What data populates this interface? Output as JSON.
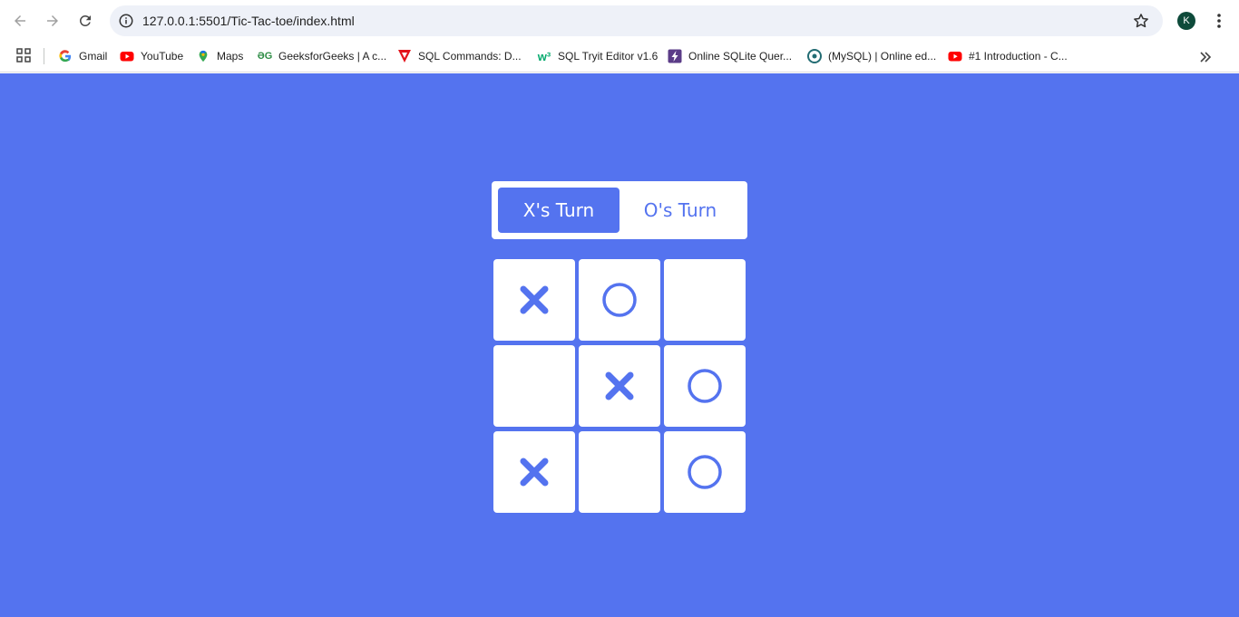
{
  "browser": {
    "url": "127.0.0.1:5501/Tic-Tac-toe/index.html",
    "profile_initial": "K",
    "bookmarks": [
      {
        "label": "Gmail",
        "icon": "google-icon"
      },
      {
        "label": "YouTube",
        "icon": "youtube-icon"
      },
      {
        "label": "Maps",
        "icon": "maps-icon"
      },
      {
        "label": "GeeksforGeeks | A c...",
        "icon": "geeksforgeeks-icon"
      },
      {
        "label": "SQL Commands: D...",
        "icon": "sql-commands-icon"
      },
      {
        "label": "SQL Tryit Editor v1.6",
        "icon": "w3schools-icon"
      },
      {
        "label": "Online SQLite Quer...",
        "icon": "sqlite-icon"
      },
      {
        "label": "(MySQL) | Online ed...",
        "icon": "onecompiler-icon"
      },
      {
        "label": "#1 Introduction - C...",
        "icon": "youtube-icon"
      }
    ]
  },
  "game": {
    "x_turn_label": "X's Turn",
    "o_turn_label": "O's Turn",
    "active_turn": "X",
    "board": [
      "X",
      "O",
      "",
      "",
      "X",
      "O",
      "X",
      "",
      "O"
    ]
  },
  "colors": {
    "accent": "#5473ef",
    "cell": "#ffffff"
  }
}
